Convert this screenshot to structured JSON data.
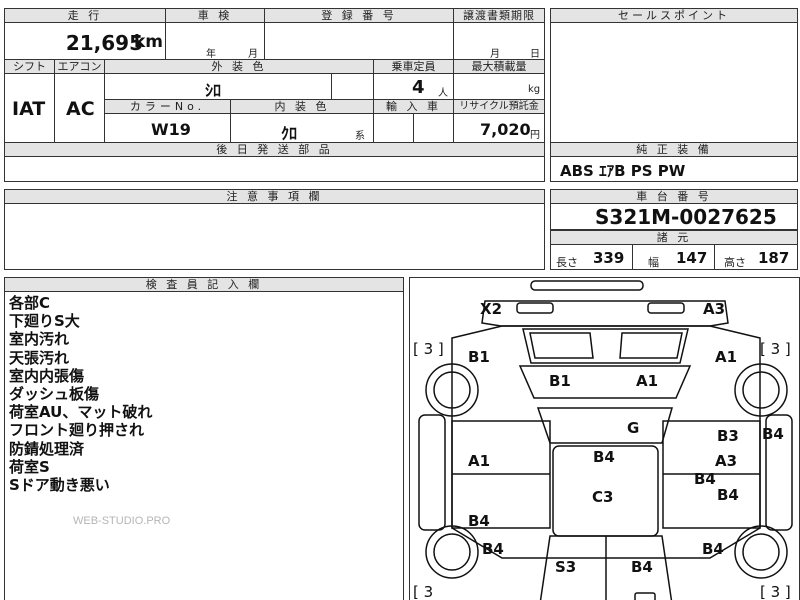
{
  "top_table": {
    "mileage_header": "走 行",
    "mileage_value": "21,695",
    "mileage_unit": "km",
    "inspection_header": "車 検",
    "inspection_year_unit": "年",
    "inspection_month_unit": "月",
    "registration_header": "登 録 番 号",
    "transfer_header": "譲渡書類期限",
    "transfer_month_unit": "月",
    "transfer_day_unit": "日",
    "shift_header": "シフト",
    "aircon_header": "エアコン",
    "exterior_header": "外 装 色",
    "capacity_header": "乗車定員",
    "max_load_header": "最大積載量",
    "shift_value": "IAT",
    "aircon_value": "AC",
    "exterior_value": "ｼﾛ",
    "capacity_value": "4",
    "capacity_unit": "人",
    "max_load_unit": "kg",
    "color_no_header": "カラーNo.",
    "interior_header": "内 装 色",
    "import_header": "輸 入 車",
    "recycle_header": "リサイクル預託金",
    "color_no_value": "W19",
    "interior_value": "ｸﾛ",
    "interior_suffix": "系",
    "recycle_value": "7,020",
    "recycle_unit": "円",
    "later_parts_header": "後 日 発 送 部 品"
  },
  "sales_point": {
    "header": "セールスポイント"
  },
  "equipment": {
    "header": "純 正 装 備",
    "value": "ABS ｴｱB PS PW"
  },
  "caution": {
    "header": "注 意 事 項 欄"
  },
  "chassis": {
    "header": "車 台 番 号",
    "value": "S321M-0027625"
  },
  "specs": {
    "header": "諸 元",
    "length_label": "長さ",
    "length_value": "339",
    "width_label": "幅",
    "width_value": "147",
    "height_label": "高さ",
    "height_value": "187"
  },
  "inspector": {
    "header": "検 査 員 記 入 欄",
    "notes": [
      "各部C",
      "下廻りS大",
      "室内汚れ",
      "天張汚れ",
      "室内内張傷",
      "ダッシュ板傷",
      "荷室AU、マット破れ",
      "フロント廻り押され",
      "防錆処理済",
      "荷室S",
      "Sドア動き悪い"
    ],
    "watermark": "WEB-STUDIO.PRO"
  },
  "diagram": {
    "tire_left_top": "[ 3 ]",
    "tire_right_top": "[ 3 ]",
    "tire_left_bottom": "[ 3",
    "tire_right_bottom": "[ 3 ]",
    "codes": {
      "roof_left": "X2",
      "roof_right": "A3",
      "front_left": "B1",
      "front_right": "A1",
      "hood_left": "B1",
      "hood_right": "A1",
      "glass": "G",
      "roof_center": "B4",
      "left_door": "A1",
      "right_upper": "B3",
      "right_mid": "A3",
      "right_mid2": "B4",
      "right_lower": "B4",
      "right_side": "B4",
      "center": "C3",
      "left_lower": "B4",
      "rear_left": "B4",
      "rear_right": "B4",
      "bottom_left": "S3",
      "bottom_right": "B4"
    }
  }
}
